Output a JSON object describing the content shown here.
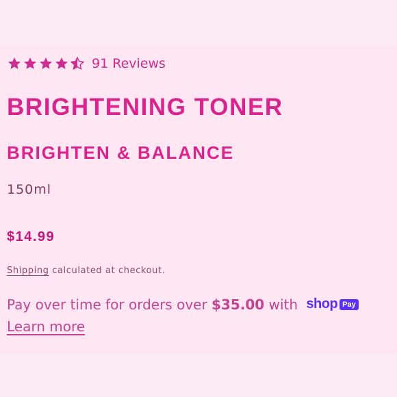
{
  "colors": {
    "page_background": "#fce6f1",
    "panel_background": "#ffe6f3",
    "accent_pink": "#d9248e",
    "shop_pay_purple": "#5a31f4"
  },
  "rating": {
    "stars": 4.5,
    "max_stars": 5,
    "reviews_label": "91 Reviews"
  },
  "product": {
    "title": "BRIGHTENING TONER",
    "subtitle": "BRIGHTEN & BALANCE",
    "size": "150ml",
    "price": "$14.99"
  },
  "shipping": {
    "link_label": "Shipping",
    "note": " calculated at checkout."
  },
  "installments": {
    "prefix": "Pay over time for orders over ",
    "amount": "$35.00",
    "suffix": " with",
    "shop_word": "shop",
    "pay_badge": "Pay",
    "learn_more": "Learn more"
  }
}
